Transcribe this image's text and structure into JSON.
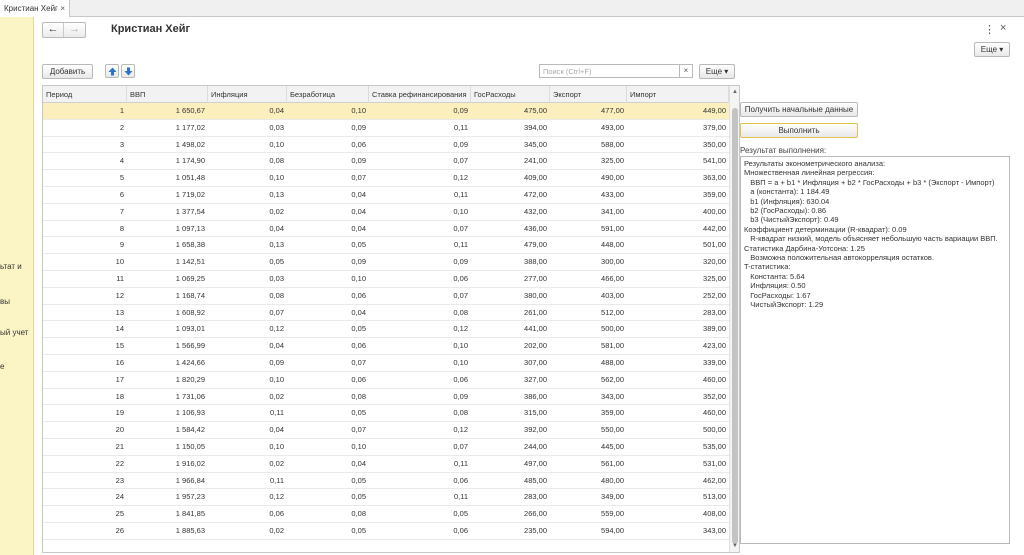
{
  "tab": {
    "title": "Кристиан Хейг",
    "close": "×"
  },
  "sidebar": {
    "items": [
      "ьтат и",
      "вы",
      "ый учет",
      "е"
    ]
  },
  "window": {
    "title": "Кристиан Хейг",
    "nav_back": "←",
    "nav_forward": "→",
    "menu_icon": "⋮",
    "close_icon": "×",
    "more_top_label": "Еще ▾"
  },
  "toolbar": {
    "add_label": "Добавить",
    "search_placeholder": "Поиск (Ctrl+F)",
    "search_value": "",
    "search_clear": "×",
    "more_label": "Еще ▾"
  },
  "table": {
    "columns": [
      "Период",
      "ВВП",
      "Инфляция",
      "Безработица",
      "Ставка рефинансирования",
      "ГосРасходы",
      "Экспорт",
      "Импорт"
    ],
    "rows": [
      [
        "1",
        "1 650,67",
        "0,04",
        "0,10",
        "0,09",
        "475,00",
        "477,00",
        "449,00"
      ],
      [
        "2",
        "1 177,02",
        "0,03",
        "0,09",
        "0,11",
        "394,00",
        "493,00",
        "379,00"
      ],
      [
        "3",
        "1 498,02",
        "0,10",
        "0,06",
        "0,09",
        "345,00",
        "588,00",
        "350,00"
      ],
      [
        "4",
        "1 174,90",
        "0,08",
        "0,09",
        "0,07",
        "241,00",
        "325,00",
        "541,00"
      ],
      [
        "5",
        "1 051,48",
        "0,10",
        "0,07",
        "0,12",
        "409,00",
        "490,00",
        "363,00"
      ],
      [
        "6",
        "1 719,02",
        "0,13",
        "0,04",
        "0,11",
        "472,00",
        "433,00",
        "359,00"
      ],
      [
        "7",
        "1 377,54",
        "0,02",
        "0,04",
        "0,10",
        "432,00",
        "341,00",
        "400,00"
      ],
      [
        "8",
        "1 097,13",
        "0,04",
        "0,04",
        "0,07",
        "436,00",
        "591,00",
        "442,00"
      ],
      [
        "9",
        "1 658,38",
        "0,13",
        "0,05",
        "0,11",
        "479,00",
        "448,00",
        "501,00"
      ],
      [
        "10",
        "1 142,51",
        "0,05",
        "0,09",
        "0,09",
        "388,00",
        "300,00",
        "320,00"
      ],
      [
        "11",
        "1 069,25",
        "0,03",
        "0,10",
        "0,06",
        "277,00",
        "466,00",
        "325,00"
      ],
      [
        "12",
        "1 168,74",
        "0,08",
        "0,06",
        "0,07",
        "380,00",
        "403,00",
        "252,00"
      ],
      [
        "13",
        "1 608,92",
        "0,07",
        "0,04",
        "0,08",
        "261,00",
        "512,00",
        "283,00"
      ],
      [
        "14",
        "1 093,01",
        "0,12",
        "0,05",
        "0,12",
        "441,00",
        "500,00",
        "389,00"
      ],
      [
        "15",
        "1 566,99",
        "0,04",
        "0,06",
        "0,10",
        "202,00",
        "581,00",
        "423,00"
      ],
      [
        "16",
        "1 424,66",
        "0,09",
        "0,07",
        "0,10",
        "307,00",
        "488,00",
        "339,00"
      ],
      [
        "17",
        "1 820,29",
        "0,10",
        "0,06",
        "0,06",
        "327,00",
        "562,00",
        "460,00"
      ],
      [
        "18",
        "1 731,06",
        "0,02",
        "0,08",
        "0,09",
        "386,00",
        "343,00",
        "352,00"
      ],
      [
        "19",
        "1 106,93",
        "0,11",
        "0,05",
        "0,08",
        "315,00",
        "359,00",
        "460,00"
      ],
      [
        "20",
        "1 584,42",
        "0,04",
        "0,07",
        "0,12",
        "392,00",
        "550,00",
        "500,00"
      ],
      [
        "21",
        "1 150,05",
        "0,10",
        "0,10",
        "0,07",
        "244,00",
        "445,00",
        "535,00"
      ],
      [
        "22",
        "1 916,02",
        "0,02",
        "0,04",
        "0,11",
        "497,00",
        "561,00",
        "531,00"
      ],
      [
        "23",
        "1 966,84",
        "0,11",
        "0,05",
        "0,06",
        "485,00",
        "480,00",
        "462,00"
      ],
      [
        "24",
        "1 957,23",
        "0,12",
        "0,05",
        "0,11",
        "283,00",
        "349,00",
        "513,00"
      ],
      [
        "25",
        "1 841,85",
        "0,06",
        "0,08",
        "0,05",
        "266,00",
        "559,00",
        "408,00"
      ],
      [
        "26",
        "1 885,63",
        "0,02",
        "0,05",
        "0,06",
        "235,00",
        "594,00",
        "343,00"
      ]
    ]
  },
  "actions": {
    "get_data_label": "Получить начальные данные",
    "run_label": "Выполнить"
  },
  "result": {
    "label": "Результат выполнения:",
    "lines": [
      "Результаты эконометрического анализа:",
      "Множественная линейная регрессия:",
      "   ВВП = a + b1 * Инфляция + b2 * ГосРасходы + b3 * (Экспорт - Импорт)",
      "   a (константа): 1 184.49",
      "   b1 (Инфляция): 630.04",
      "   b2 (ГосРасходы): 0.86",
      "   b3 (ЧистыйЭкспорт): 0.49",
      "Коэффициент детерминации (R-квадрат): 0.09",
      "   R-квадрат низкий, модель объясняет небольшую часть вариации ВВП.",
      "Статистика Дарбина-Уотсона: 1.25",
      "   Возможна положительная автокорреляция остатков.",
      "T-статистика:",
      "   Константа: 5.64",
      "   Инфляция: 0.50",
      "   ГосРасходы: 1.67",
      "   ЧистыйЭкспорт: 1.29"
    ]
  },
  "colors": {
    "sidebar_bg": "#fbf4c4",
    "selected_row": "#fbefbd",
    "run_button_border": "#e2c04a"
  }
}
